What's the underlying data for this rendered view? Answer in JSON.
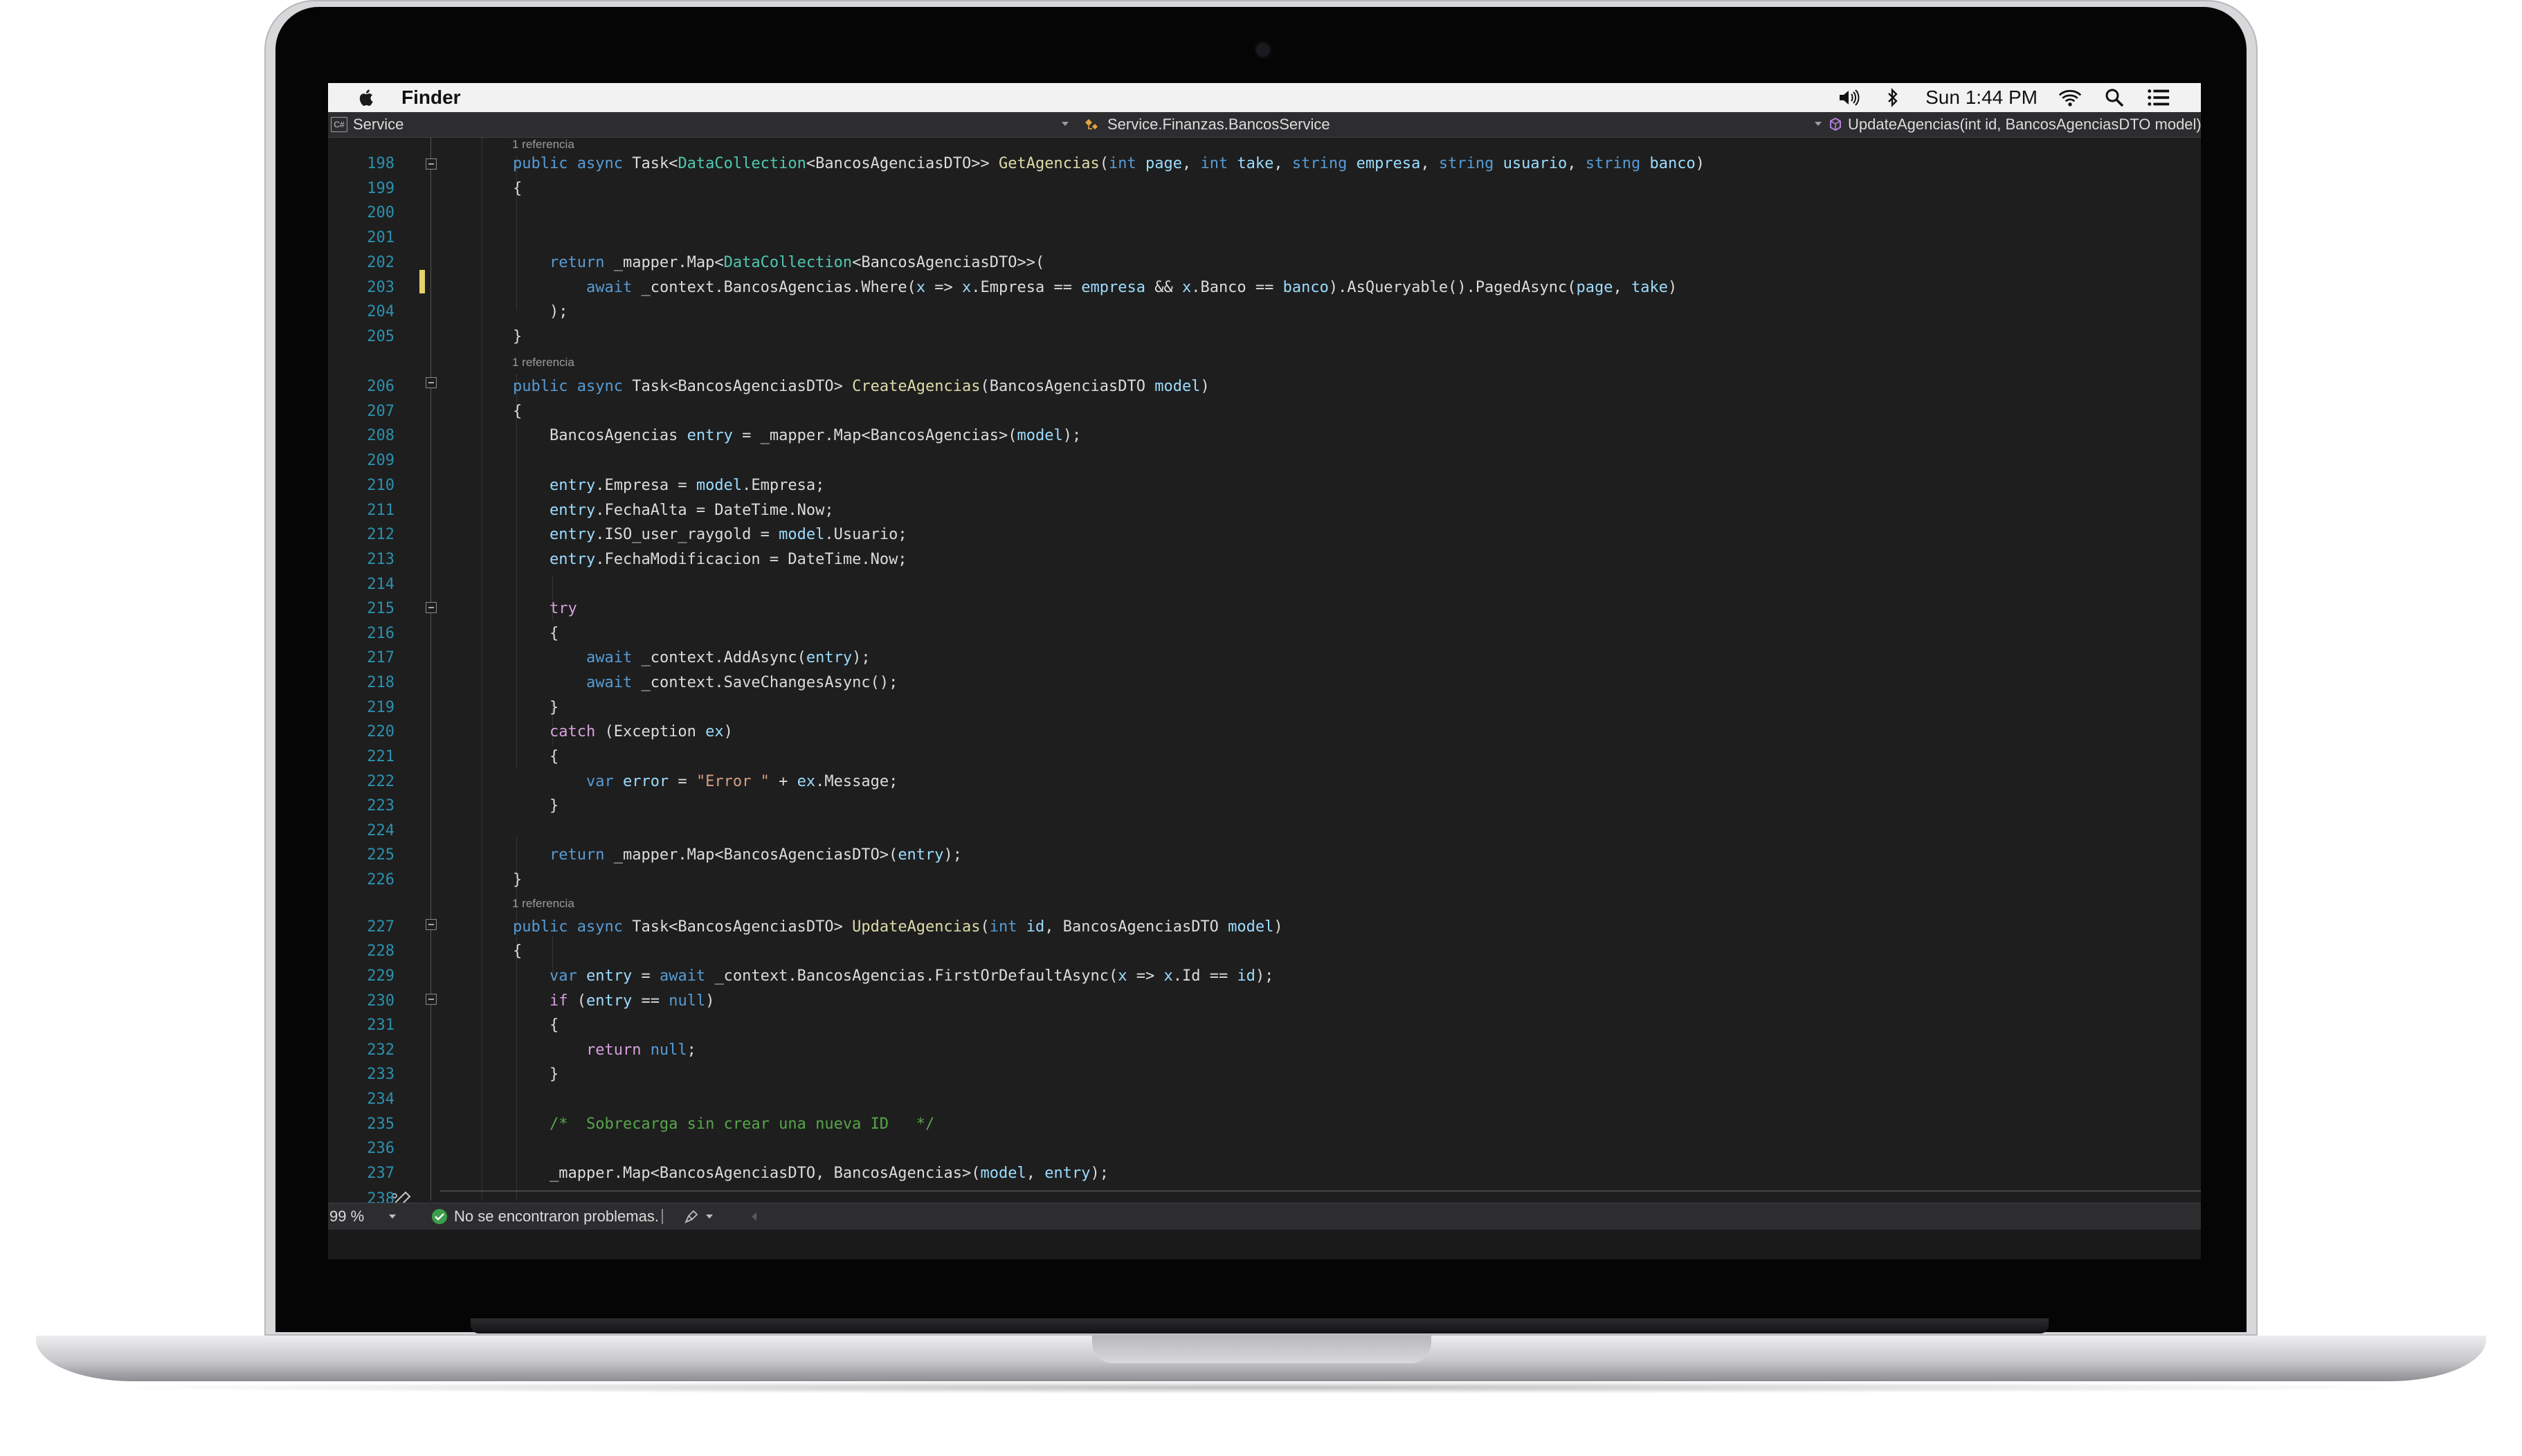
{
  "menubar": {
    "app_name": "Finder",
    "clock": "Sun 1:44 PM",
    "icons": [
      "apple-icon",
      "volume-icon",
      "bluetooth-icon",
      "wifi-icon",
      "spotlight-search-icon",
      "notification-list-icon"
    ]
  },
  "navbar": {
    "project": "Service",
    "class_path": "Service.Finanzas.BancosService",
    "member": "UpdateAgencias(int id, BancosAgenciasDTO model)"
  },
  "editor": {
    "reference_label": "1 referencia",
    "lines": [
      {
        "num": "198"
      },
      {
        "num": "199"
      },
      {
        "num": "200"
      },
      {
        "num": "201"
      },
      {
        "num": "202"
      },
      {
        "num": "203"
      },
      {
        "num": "204"
      },
      {
        "num": "205"
      },
      {
        "num": "206"
      },
      {
        "num": "207"
      },
      {
        "num": "208"
      },
      {
        "num": "209"
      },
      {
        "num": "210"
      },
      {
        "num": "211"
      },
      {
        "num": "212"
      },
      {
        "num": "213"
      },
      {
        "num": "214"
      },
      {
        "num": "215"
      },
      {
        "num": "216"
      },
      {
        "num": "217"
      },
      {
        "num": "218"
      },
      {
        "num": "219"
      },
      {
        "num": "220"
      },
      {
        "num": "221"
      },
      {
        "num": "222"
      },
      {
        "num": "223"
      },
      {
        "num": "224"
      },
      {
        "num": "225"
      },
      {
        "num": "226"
      },
      {
        "num": "227"
      },
      {
        "num": "228"
      },
      {
        "num": "229"
      },
      {
        "num": "230"
      },
      {
        "num": "231"
      },
      {
        "num": "232"
      },
      {
        "num": "233"
      },
      {
        "num": "234"
      },
      {
        "num": "235"
      },
      {
        "num": "236"
      },
      {
        "num": "237"
      },
      {
        "num": "238"
      }
    ],
    "code": {
      "l198": [
        [
          "kw",
          "public "
        ],
        [
          "kw",
          "async "
        ],
        [
          "",
          "Task<"
        ],
        [
          "ty",
          "DataCollection"
        ],
        [
          "",
          "<BancosAgenciasDTO>> "
        ],
        [
          "fn",
          "GetAgencias"
        ],
        [
          "",
          "("
        ],
        [
          "kw",
          "int "
        ],
        [
          "pa",
          "page"
        ],
        [
          "",
          ", "
        ],
        [
          "kw",
          "int "
        ],
        [
          "pa",
          "take"
        ],
        [
          "",
          ", "
        ],
        [
          "kw",
          "string "
        ],
        [
          "pa",
          "empresa"
        ],
        [
          "",
          ", "
        ],
        [
          "kw",
          "string "
        ],
        [
          "pa",
          "usuario"
        ],
        [
          "",
          ", "
        ],
        [
          "kw",
          "string "
        ],
        [
          "pa",
          "banco"
        ],
        [
          "",
          ")"
        ]
      ],
      "l199": [
        [
          "",
          "{"
        ]
      ],
      "l202": [
        [
          "",
          "    "
        ],
        [
          "kw",
          "return "
        ],
        [
          "",
          "_mapper.Map<"
        ],
        [
          "ty",
          "DataCollection"
        ],
        [
          "",
          "<BancosAgenciasDTO>>("
        ]
      ],
      "l203": [
        [
          "",
          "        "
        ],
        [
          "kw",
          "await "
        ],
        [
          "",
          "_context.BancosAgencias.Where("
        ],
        [
          "pa",
          "x"
        ],
        [
          "",
          " => "
        ],
        [
          "pa",
          "x"
        ],
        [
          "",
          ".Empresa == "
        ],
        [
          "pa",
          "empresa"
        ],
        [
          "",
          " && "
        ],
        [
          "pa",
          "x"
        ],
        [
          "",
          ".Banco == "
        ],
        [
          "pa",
          "banco"
        ],
        [
          "",
          ").AsQueryable().PagedAsync("
        ],
        [
          "pa",
          "page"
        ],
        [
          "",
          ", "
        ],
        [
          "pa",
          "take"
        ],
        [
          "",
          ")"
        ]
      ],
      "l204": [
        [
          "",
          "    );"
        ]
      ],
      "l205": [
        [
          "",
          "}"
        ]
      ],
      "l206": [
        [
          "kw",
          "public "
        ],
        [
          "kw",
          "async "
        ],
        [
          "",
          "Task<BancosAgenciasDTO> "
        ],
        [
          "fn",
          "CreateAgencias"
        ],
        [
          "",
          "(BancosAgenciasDTO "
        ],
        [
          "pa",
          "model"
        ],
        [
          "",
          ")"
        ]
      ],
      "l207": [
        [
          "",
          "{"
        ]
      ],
      "l208": [
        [
          "",
          "    BancosAgencias "
        ],
        [
          "pa",
          "entry"
        ],
        [
          "",
          " = _mapper.Map<BancosAgencias>("
        ],
        [
          "pa",
          "model"
        ],
        [
          "",
          ");"
        ]
      ],
      "l210": [
        [
          "",
          "    "
        ],
        [
          "pa",
          "entry"
        ],
        [
          "",
          ".Empresa = "
        ],
        [
          "pa",
          "model"
        ],
        [
          "",
          ".Empresa;"
        ]
      ],
      "l211": [
        [
          "",
          "    "
        ],
        [
          "pa",
          "entry"
        ],
        [
          "",
          ".FechaAlta = DateTime.Now;"
        ]
      ],
      "l212": [
        [
          "",
          "    "
        ],
        [
          "pa",
          "entry"
        ],
        [
          "",
          ".ISO_user_raygold = "
        ],
        [
          "pa",
          "model"
        ],
        [
          "",
          ".Usuario;"
        ]
      ],
      "l213": [
        [
          "",
          "    "
        ],
        [
          "pa",
          "entry"
        ],
        [
          "",
          ".FechaModificacion = DateTime.Now;"
        ]
      ],
      "l215": [
        [
          "",
          "    "
        ],
        [
          "ct",
          "try"
        ]
      ],
      "l216": [
        [
          "",
          "    {"
        ]
      ],
      "l217": [
        [
          "",
          "        "
        ],
        [
          "kw",
          "await "
        ],
        [
          "",
          "_context.AddAsync("
        ],
        [
          "pa",
          "entry"
        ],
        [
          "",
          ");"
        ]
      ],
      "l218": [
        [
          "",
          "        "
        ],
        [
          "kw",
          "await "
        ],
        [
          "",
          "_context.SaveChangesAsync();"
        ]
      ],
      "l219": [
        [
          "",
          "    }"
        ]
      ],
      "l220": [
        [
          "",
          "    "
        ],
        [
          "ct",
          "catch "
        ],
        [
          "",
          "(Exception "
        ],
        [
          "pa",
          "ex"
        ],
        [
          "",
          ")"
        ]
      ],
      "l221": [
        [
          "",
          "    {"
        ]
      ],
      "l222": [
        [
          "",
          "        "
        ],
        [
          "kw",
          "var "
        ],
        [
          "pa",
          "error"
        ],
        [
          "",
          " = "
        ],
        [
          "st",
          "\"Error \""
        ],
        [
          "",
          " + "
        ],
        [
          "pa",
          "ex"
        ],
        [
          "",
          ".Message;"
        ]
      ],
      "l223": [
        [
          "",
          "    }"
        ]
      ],
      "l225": [
        [
          "",
          "    "
        ],
        [
          "kw",
          "return "
        ],
        [
          "",
          "_mapper.Map<BancosAgenciasDTO>("
        ],
        [
          "pa",
          "entry"
        ],
        [
          "",
          ");"
        ]
      ],
      "l226": [
        [
          "",
          "}"
        ]
      ],
      "l227": [
        [
          "kw",
          "public "
        ],
        [
          "kw",
          "async "
        ],
        [
          "",
          "Task<BancosAgenciasDTO> "
        ],
        [
          "fn",
          "UpdateAgencias"
        ],
        [
          "",
          "("
        ],
        [
          "kw",
          "int "
        ],
        [
          "pa",
          "id"
        ],
        [
          "",
          ", BancosAgenciasDTO "
        ],
        [
          "pa",
          "model"
        ],
        [
          "",
          ")"
        ]
      ],
      "l228": [
        [
          "",
          "{"
        ]
      ],
      "l229": [
        [
          "",
          "    "
        ],
        [
          "kw",
          "var "
        ],
        [
          "pa",
          "entry"
        ],
        [
          "",
          " = "
        ],
        [
          "kw",
          "await "
        ],
        [
          "",
          "_context.BancosAgencias.FirstOrDefaultAsync("
        ],
        [
          "pa",
          "x"
        ],
        [
          "",
          " => "
        ],
        [
          "pa",
          "x"
        ],
        [
          "",
          ".Id == "
        ],
        [
          "pa",
          "id"
        ],
        [
          "",
          ");"
        ]
      ],
      "l230": [
        [
          "",
          "    "
        ],
        [
          "ct",
          "if "
        ],
        [
          "",
          "("
        ],
        [
          "pa",
          "entry"
        ],
        [
          "",
          " == "
        ],
        [
          "kw",
          "null"
        ],
        [
          "",
          ")"
        ]
      ],
      "l231": [
        [
          "",
          "    {"
        ]
      ],
      "l232": [
        [
          "",
          "        "
        ],
        [
          "ct",
          "return "
        ],
        [
          "kw",
          "null"
        ],
        [
          "",
          ";"
        ]
      ],
      "l233": [
        [
          "",
          "    }"
        ]
      ],
      "l235": [
        [
          "",
          "    "
        ],
        [
          "cm",
          "/*  Sobrecarga sin crear una nueva ID   */"
        ]
      ],
      "l237": [
        [
          "",
          "    _mapper.Map<BancosAgenciasDTO, BancosAgencias>("
        ],
        [
          "pa",
          "model"
        ],
        [
          "",
          ", "
        ],
        [
          "pa",
          "entry"
        ],
        [
          "",
          ");"
        ]
      ]
    }
  },
  "statusbar": {
    "zoom": "99 %",
    "problems": "No se encontraron problemas."
  }
}
